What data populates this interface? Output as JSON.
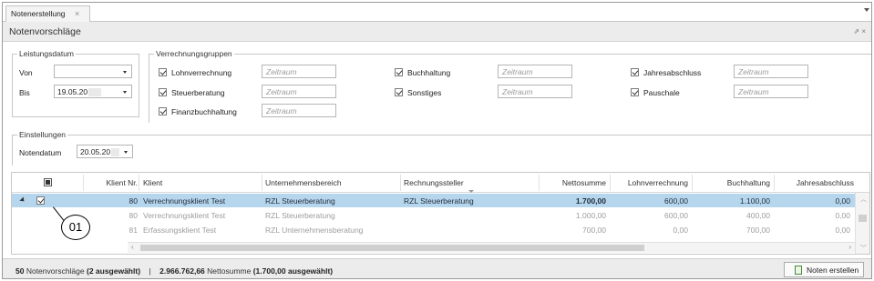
{
  "tab": {
    "label": "Notenerstellung",
    "close": "×"
  },
  "panel": {
    "title": "Notenvorschläge",
    "icons": "⇗ ×"
  },
  "leistungsdatum": {
    "legend": "Leistungsdatum",
    "von_label": "Von",
    "von_value": "",
    "bis_label": "Bis",
    "bis_value": "19.05.20"
  },
  "verrechnungsgruppen": {
    "legend": "Verrechnungsgruppen",
    "placeholder": "Zeitraum",
    "items": [
      {
        "label": "Lohnverrechnung",
        "checked": true
      },
      {
        "label": "Steuerberatung",
        "checked": true
      },
      {
        "label": "Finanzbuchhaltung",
        "checked": true
      },
      {
        "label": "Buchhaltung",
        "checked": true
      },
      {
        "label": "Sonstiges",
        "checked": true
      },
      {
        "label": "Jahresabschluss",
        "checked": true
      },
      {
        "label": "Pauschale",
        "checked": true
      }
    ]
  },
  "einstellungen": {
    "legend": "Einstellungen",
    "notendatum_label": "Notendatum",
    "notendatum_value": "20.05.20"
  },
  "grid": {
    "columns": [
      "Klient Nr.",
      "Klient",
      "Unternehmensbereich",
      "Rechnungssteller",
      "Nettosumme",
      "Lohnverrechnung",
      "Buchhaltung",
      "Jahresabschluss"
    ],
    "rows": [
      {
        "nr": "80",
        "klient": "Verrechnungsklient Test",
        "bereich": "RZL Steuerberatung",
        "steller": "RZL Steuerberatung",
        "netto": "1.700,00",
        "lohn": "600,00",
        "buch": "1.100,00",
        "jahr": "0,00"
      },
      {
        "nr": "80",
        "klient": "Verrechnungsklient Test",
        "bereich": "RZL Steuerberatung",
        "steller": "",
        "netto": "1.000,00",
        "lohn": "600,00",
        "buch": "400,00",
        "jahr": "0,00"
      },
      {
        "nr": "81",
        "klient": "Erfassungsklient Test",
        "bereich": "RZL Unternehmensberatung",
        "steller": "",
        "netto": "700,00",
        "lohn": "0,00",
        "buch": "700,00",
        "jahr": "0,00"
      }
    ]
  },
  "callout": "01",
  "status": {
    "count": "50",
    "count_text": " Notenvorschläge ",
    "selected": "(2 ausgewählt)",
    "sep": "|",
    "total": "2.966.762,66",
    "total_text": " Nettosumme ",
    "total_selected": "(1.700,00 ausgewählt)"
  },
  "button": {
    "label": "Noten erstellen"
  }
}
